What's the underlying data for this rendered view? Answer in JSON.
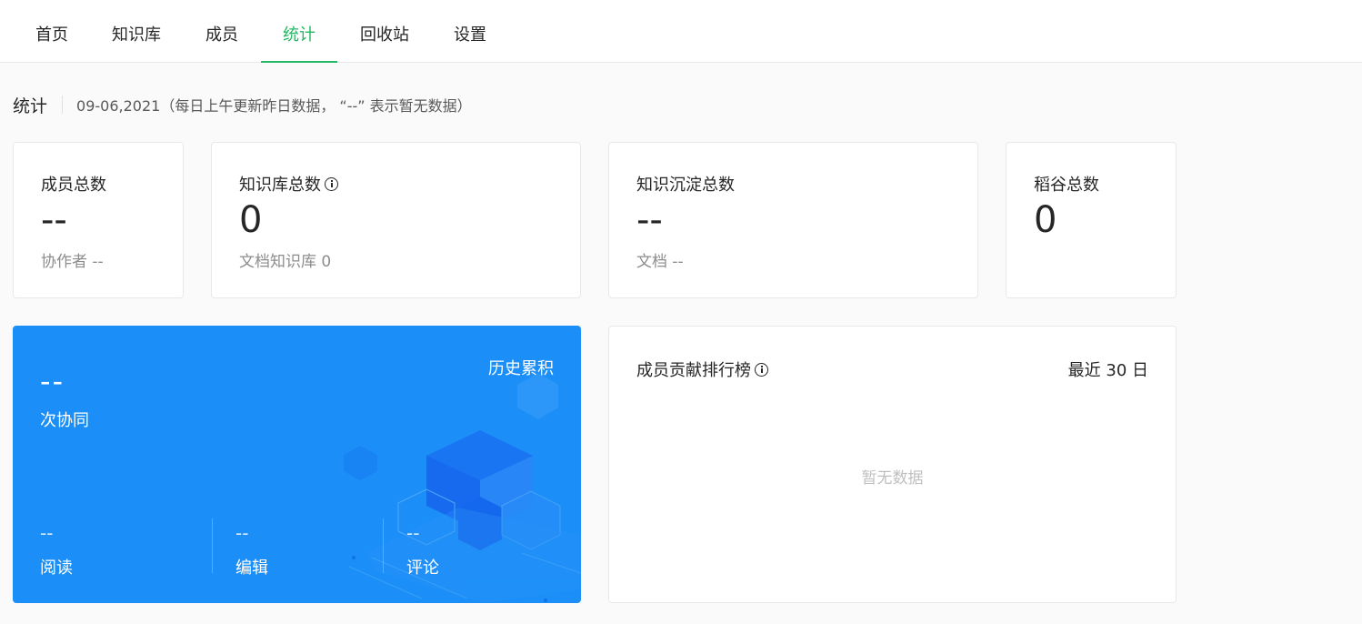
{
  "nav": {
    "tabs": [
      "首页",
      "知识库",
      "成员",
      "统计",
      "回收站",
      "设置"
    ],
    "active": "统计"
  },
  "header": {
    "title": "统计",
    "note": "09-06,2021（每日上午更新昨日数据， “--” 表示暂无数据）"
  },
  "cards": {
    "members": {
      "label": "成员总数",
      "value": "--",
      "sub": "协作者 --"
    },
    "books": {
      "label": "知识库总数",
      "value": "0",
      "sub": "文档知识库 0"
    },
    "knowledge": {
      "label": "知识沉淀总数",
      "value": "--",
      "sub": "文档 --"
    },
    "rice": {
      "label": "稻谷总数",
      "value": "0"
    }
  },
  "collab": {
    "value": "--",
    "label": "次协同",
    "history": "历史累积",
    "read": {
      "value": "--",
      "label": "阅读"
    },
    "edit": {
      "value": "--",
      "label": "编辑"
    },
    "comment": {
      "value": "--",
      "label": "评论"
    }
  },
  "ranking": {
    "title": "成员贡献排行榜",
    "range": "最近 30 日",
    "empty": "暂无数据"
  },
  "colors": {
    "accent": "#25b864",
    "panel": "#1b8ff7"
  },
  "icons": {
    "info": "info-icon"
  }
}
